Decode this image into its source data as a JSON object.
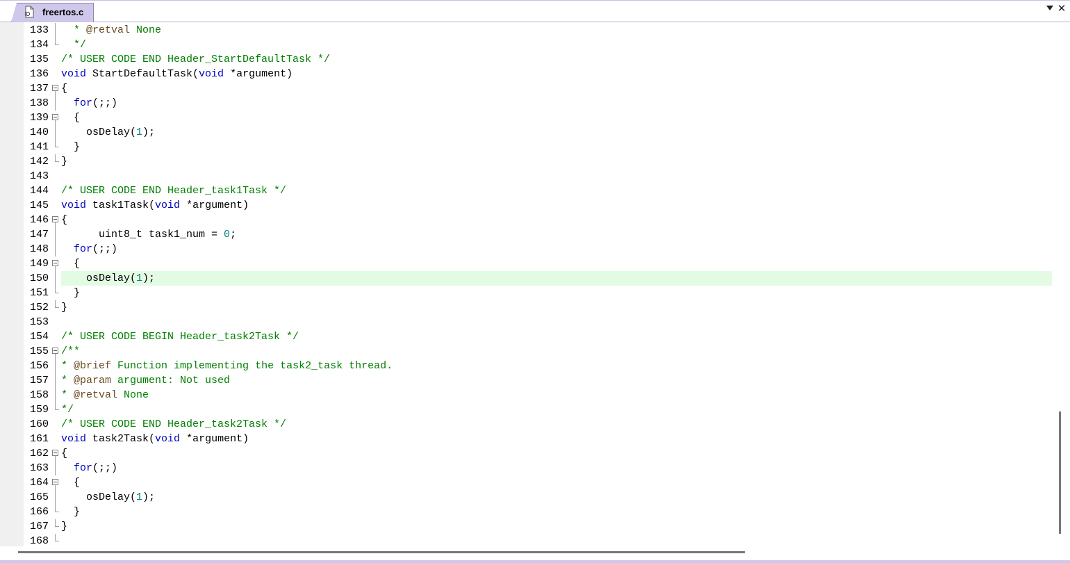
{
  "tab": {
    "label": "freertos.c",
    "icon": "c-source-file-icon",
    "menu_icon": "chevron-down-icon",
    "close_icon": "close-icon"
  },
  "editor": {
    "highlighted_line": "150",
    "lines": [
      {
        "n": "133",
        "fold": "line",
        "segs": [
          {
            "t": "  * ",
            "c": "cm"
          },
          {
            "t": "@retval",
            "c": "tag"
          },
          {
            "t": " None",
            "c": "cm"
          }
        ]
      },
      {
        "n": "134",
        "fold": "end",
        "segs": [
          {
            "t": "  */",
            "c": "cm"
          }
        ]
      },
      {
        "n": "135",
        "fold": "",
        "segs": [
          {
            "t": "/* USER CODE END Header_StartDefaultTask */",
            "c": "cm"
          }
        ]
      },
      {
        "n": "136",
        "fold": "",
        "segs": [
          {
            "t": "void",
            "c": "kw"
          },
          {
            "t": " StartDefaultTask(",
            "c": ""
          },
          {
            "t": "void",
            "c": "kw"
          },
          {
            "t": " *argument)",
            "c": ""
          }
        ]
      },
      {
        "n": "137",
        "fold": "box",
        "segs": [
          {
            "t": "{",
            "c": ""
          }
        ]
      },
      {
        "n": "138",
        "fold": "line",
        "segs": [
          {
            "t": "  ",
            "c": ""
          },
          {
            "t": "for",
            "c": "kw"
          },
          {
            "t": "(;;)",
            "c": ""
          }
        ]
      },
      {
        "n": "139",
        "fold": "box",
        "segs": [
          {
            "t": "  {",
            "c": ""
          }
        ]
      },
      {
        "n": "140",
        "fold": "line",
        "segs": [
          {
            "t": "    osDelay(",
            "c": ""
          },
          {
            "t": "1",
            "c": "num"
          },
          {
            "t": ");",
            "c": ""
          }
        ]
      },
      {
        "n": "141",
        "fold": "end",
        "segs": [
          {
            "t": "  }",
            "c": ""
          }
        ]
      },
      {
        "n": "142",
        "fold": "end",
        "segs": [
          {
            "t": "}",
            "c": ""
          }
        ]
      },
      {
        "n": "143",
        "fold": "",
        "segs": []
      },
      {
        "n": "144",
        "fold": "",
        "segs": [
          {
            "t": "/* USER CODE END Header_task1Task */",
            "c": "cm"
          }
        ]
      },
      {
        "n": "145",
        "fold": "",
        "segs": [
          {
            "t": "void",
            "c": "kw"
          },
          {
            "t": " task1Task(",
            "c": ""
          },
          {
            "t": "void",
            "c": "kw"
          },
          {
            "t": " *argument)",
            "c": ""
          }
        ]
      },
      {
        "n": "146",
        "fold": "box",
        "segs": [
          {
            "t": "{",
            "c": ""
          }
        ]
      },
      {
        "n": "147",
        "fold": "line",
        "segs": [
          {
            "t": "      uint8_t task1_num = ",
            "c": ""
          },
          {
            "t": "0",
            "c": "num"
          },
          {
            "t": ";",
            "c": ""
          }
        ]
      },
      {
        "n": "148",
        "fold": "line",
        "segs": [
          {
            "t": "  ",
            "c": ""
          },
          {
            "t": "for",
            "c": "kw"
          },
          {
            "t": "(;;)",
            "c": ""
          }
        ]
      },
      {
        "n": "149",
        "fold": "box",
        "segs": [
          {
            "t": "  {",
            "c": ""
          }
        ]
      },
      {
        "n": "150",
        "fold": "line",
        "segs": [
          {
            "t": "    osDelay(",
            "c": ""
          },
          {
            "t": "1",
            "c": "num"
          },
          {
            "t": ");",
            "c": ""
          }
        ]
      },
      {
        "n": "151",
        "fold": "end",
        "segs": [
          {
            "t": "  }",
            "c": ""
          }
        ]
      },
      {
        "n": "152",
        "fold": "end",
        "segs": [
          {
            "t": "}",
            "c": ""
          }
        ]
      },
      {
        "n": "153",
        "fold": "",
        "segs": []
      },
      {
        "n": "154",
        "fold": "",
        "segs": [
          {
            "t": "/* USER CODE BEGIN Header_task2Task */",
            "c": "cm"
          }
        ]
      },
      {
        "n": "155",
        "fold": "box",
        "segs": [
          {
            "t": "/**",
            "c": "cm"
          }
        ]
      },
      {
        "n": "156",
        "fold": "line",
        "segs": [
          {
            "t": "* ",
            "c": "cm"
          },
          {
            "t": "@brief",
            "c": "tag"
          },
          {
            "t": " Function implementing the task2_task thread.",
            "c": "cm"
          }
        ]
      },
      {
        "n": "157",
        "fold": "line",
        "segs": [
          {
            "t": "* ",
            "c": "cm"
          },
          {
            "t": "@param",
            "c": "tag"
          },
          {
            "t": " argument: Not used",
            "c": "cm"
          }
        ]
      },
      {
        "n": "158",
        "fold": "line",
        "segs": [
          {
            "t": "* ",
            "c": "cm"
          },
          {
            "t": "@retval",
            "c": "tag"
          },
          {
            "t": " None",
            "c": "cm"
          }
        ]
      },
      {
        "n": "159",
        "fold": "end",
        "segs": [
          {
            "t": "*/",
            "c": "cm"
          }
        ]
      },
      {
        "n": "160",
        "fold": "",
        "segs": [
          {
            "t": "/* USER CODE END Header_task2Task */",
            "c": "cm"
          }
        ]
      },
      {
        "n": "161",
        "fold": "",
        "segs": [
          {
            "t": "void",
            "c": "kw"
          },
          {
            "t": " task2Task(",
            "c": ""
          },
          {
            "t": "void",
            "c": "kw"
          },
          {
            "t": " *argument)",
            "c": ""
          }
        ]
      },
      {
        "n": "162",
        "fold": "box",
        "segs": [
          {
            "t": "{",
            "c": ""
          }
        ]
      },
      {
        "n": "163",
        "fold": "line",
        "segs": [
          {
            "t": "  ",
            "c": ""
          },
          {
            "t": "for",
            "c": "kw"
          },
          {
            "t": "(;;)",
            "c": ""
          }
        ]
      },
      {
        "n": "164",
        "fold": "box",
        "segs": [
          {
            "t": "  {",
            "c": ""
          }
        ]
      },
      {
        "n": "165",
        "fold": "line",
        "segs": [
          {
            "t": "    osDelay(",
            "c": ""
          },
          {
            "t": "1",
            "c": "num"
          },
          {
            "t": ");",
            "c": ""
          }
        ]
      },
      {
        "n": "166",
        "fold": "end",
        "segs": [
          {
            "t": "  }",
            "c": ""
          }
        ]
      },
      {
        "n": "167",
        "fold": "end",
        "segs": [
          {
            "t": "}",
            "c": ""
          }
        ]
      },
      {
        "n": "168",
        "fold": "end",
        "segs": []
      }
    ]
  },
  "scrollbars": {
    "vertical_position": 0.76,
    "horizontal_position": 0.0
  },
  "colors": {
    "keyword": "#0000c0",
    "comment": "#008000",
    "doc_tag": "#6b4c24",
    "number": "#008080",
    "current_line": "#e3fbe3",
    "tab_active": "#cfc8ea"
  }
}
